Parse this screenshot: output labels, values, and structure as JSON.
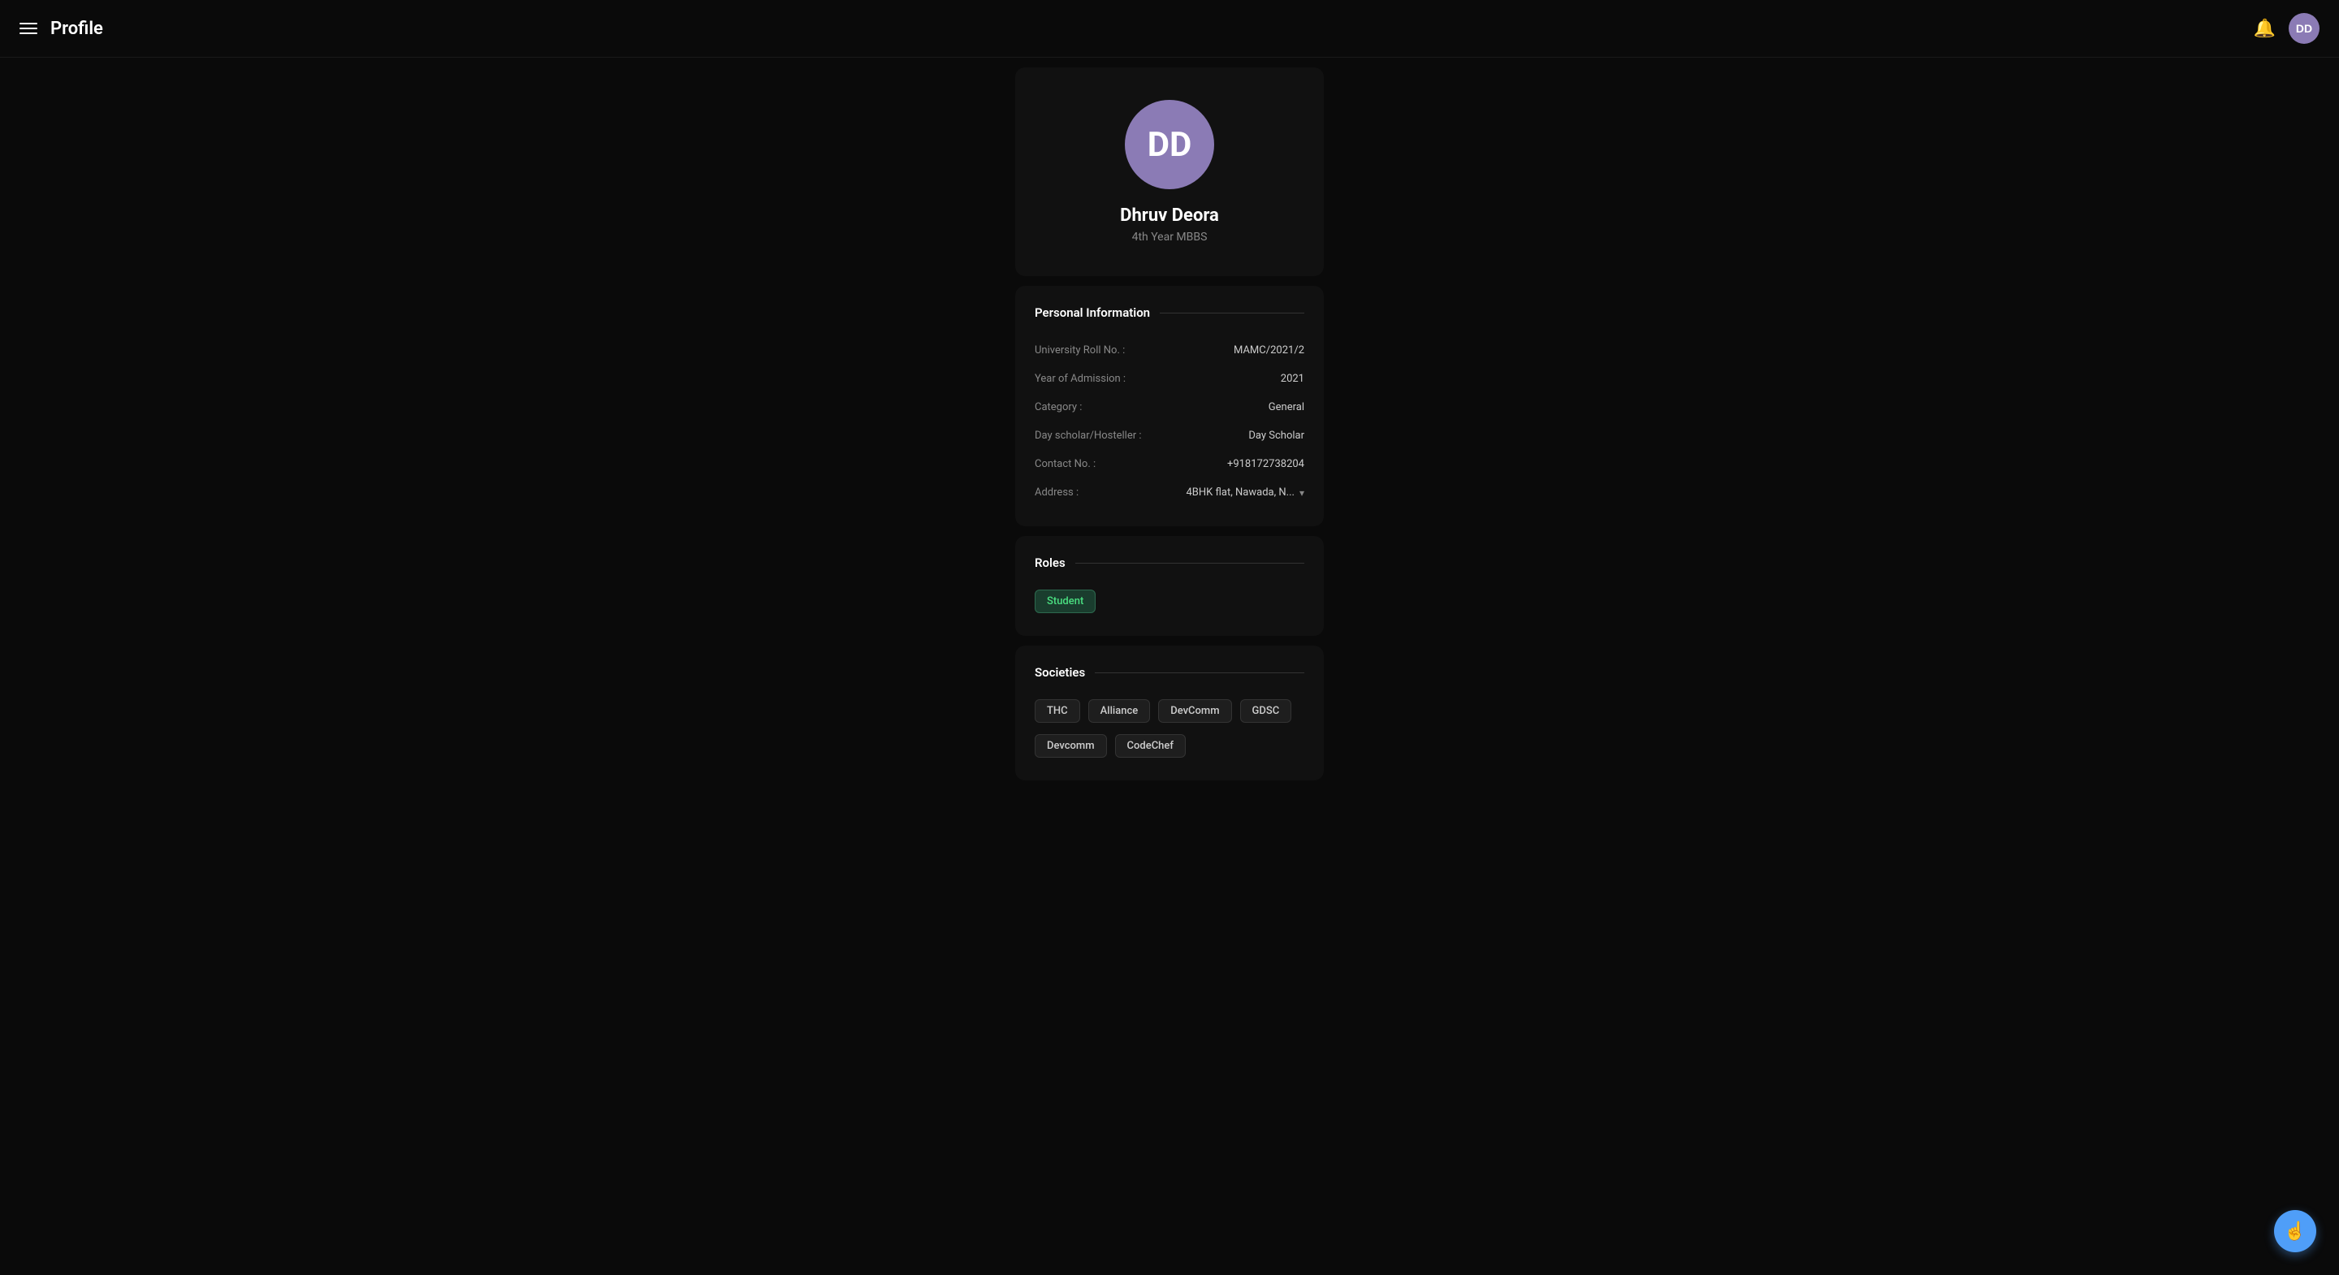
{
  "header": {
    "title": "Profile",
    "menu_icon": "hamburger",
    "bell_icon": "bell",
    "user_initials": "DD"
  },
  "profile": {
    "initials": "DD",
    "name": "Dhruv Deora",
    "subtitle": "4th Year MBBS"
  },
  "personal_info": {
    "section_title": "Personal Information",
    "fields": [
      {
        "label": "University Roll No. :",
        "value": "MAMC/2021/2"
      },
      {
        "label": "Year of Admission :",
        "value": "2021"
      },
      {
        "label": "Category :",
        "value": "General"
      },
      {
        "label": "Day scholar/Hosteller :",
        "value": "Day Scholar"
      },
      {
        "label": "Contact No. :",
        "value": "+918172738204"
      },
      {
        "label": "Address :",
        "value": "4BHK flat, Nawada, N...",
        "has_chevron": true
      }
    ]
  },
  "roles": {
    "section_title": "Roles",
    "items": [
      {
        "label": "Student",
        "type": "green"
      }
    ]
  },
  "societies": {
    "section_title": "Societies",
    "items": [
      {
        "label": "THC",
        "type": "gray"
      },
      {
        "label": "Alliance",
        "type": "gray"
      },
      {
        "label": "DevComm",
        "type": "gray"
      },
      {
        "label": "GDSC",
        "type": "gray"
      },
      {
        "label": "Devcomm",
        "type": "gray"
      },
      {
        "label": "CodeChef",
        "type": "gray"
      }
    ]
  },
  "fab": {
    "icon": "hand-pointer-icon"
  }
}
